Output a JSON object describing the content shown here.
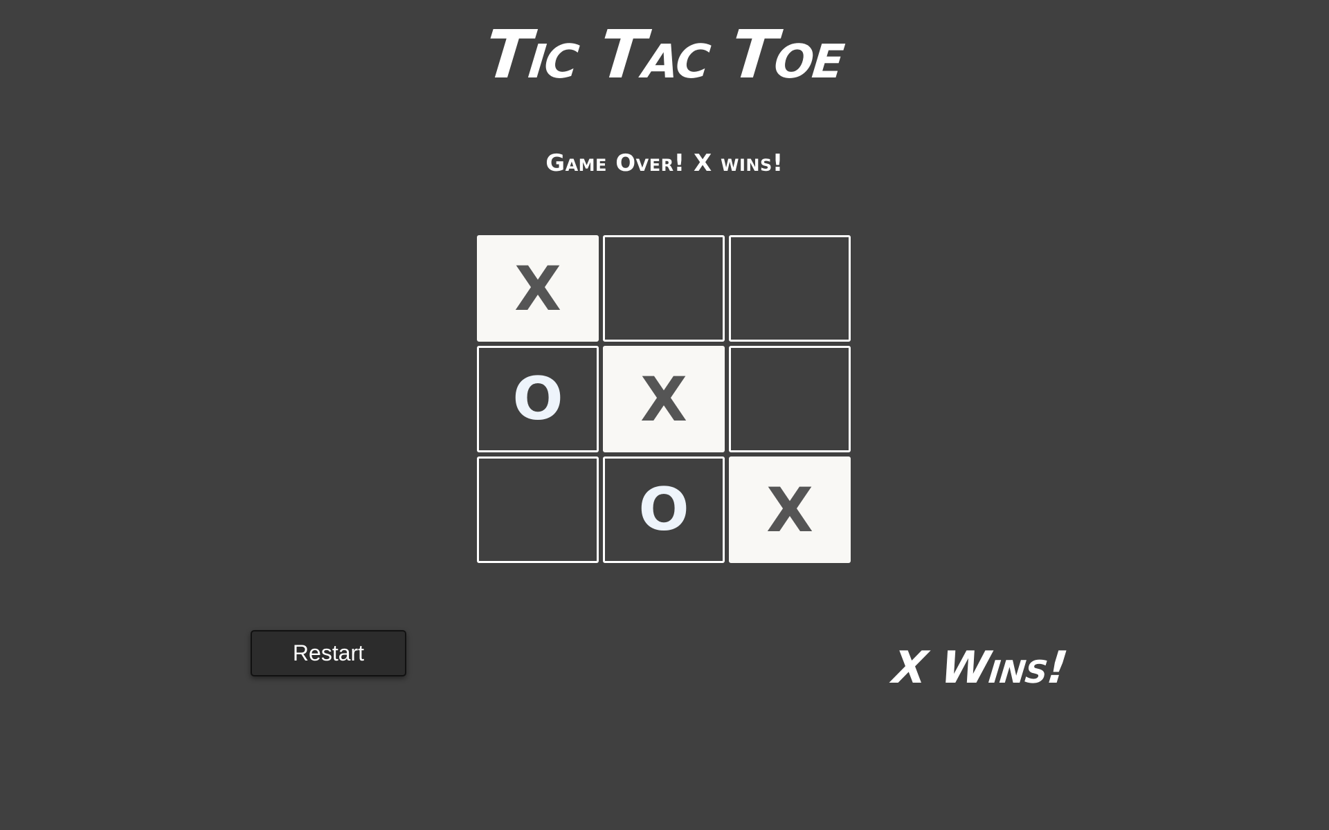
{
  "header": {
    "title": "Tic Tac Toe"
  },
  "status": {
    "message": "Game Over! X wins!"
  },
  "board": {
    "cells": [
      {
        "mark": "X",
        "winning": true
      },
      {
        "mark": "",
        "winning": false
      },
      {
        "mark": "",
        "winning": false
      },
      {
        "mark": "O",
        "winning": false
      },
      {
        "mark": "X",
        "winning": true
      },
      {
        "mark": "",
        "winning": false
      },
      {
        "mark": "",
        "winning": false
      },
      {
        "mark": "O",
        "winning": false
      },
      {
        "mark": "X",
        "winning": true
      }
    ]
  },
  "controls": {
    "restart_label": "Restart"
  },
  "result": {
    "winner_text": "X Wins!"
  },
  "colors": {
    "background": "#404040",
    "cell_border": "#ffffff",
    "winning_cell": "#f9f8f5",
    "winning_mark": "#555555",
    "o_mark": "#eef4fb"
  }
}
